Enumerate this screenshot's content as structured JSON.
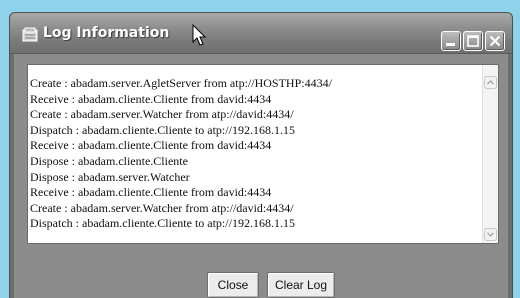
{
  "window": {
    "title": "Log Information",
    "title_icon": "app-icon",
    "controls": [
      "minimize-icon",
      "maximize-icon",
      "close-icon"
    ]
  },
  "log": {
    "lines": [
      "Create : abadam.server.AgletServer from atp://HOSTHP:4434/",
      "Receive : abadam.cliente.Cliente from david:4434",
      "Create : abadam.server.Watcher from atp://david:4434/",
      "Dispatch : abadam.cliente.Cliente to atp://192.168.1.15",
      "Receive : abadam.cliente.Cliente from david:4434",
      "Dispose : abadam.cliente.Cliente",
      "Dispose : abadam.server.Watcher",
      "Receive : abadam.cliente.Cliente from david:4434",
      "Create : abadam.server.Watcher from atp://david:4434/",
      "Dispatch : abadam.cliente.Cliente to atp://192.168.1.15"
    ]
  },
  "buttons": {
    "close_label": "Close",
    "clear_log_label": "Clear Log"
  },
  "colors": {
    "page_background": "#8fd3ea",
    "window_frame": "#6d6d6d",
    "client_area": "#8c8c8c",
    "log_background": "#ffffff"
  }
}
